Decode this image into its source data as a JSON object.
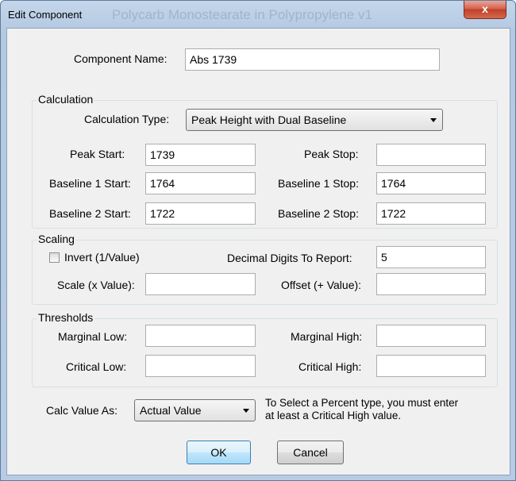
{
  "window": {
    "title": "Edit Component",
    "background_title": "Polycarb Monostearate in Polypropylene v1",
    "close_glyph": "x"
  },
  "component_name": {
    "label": "Component Name:",
    "value": "Abs 1739"
  },
  "calculation": {
    "group_title": "Calculation",
    "type_label": "Calculation Type:",
    "type_value": "Peak Height with Dual Baseline",
    "peak_start_label": "Peak Start:",
    "peak_start_value": "1739",
    "peak_stop_label": "Peak Stop:",
    "peak_stop_value": "",
    "b1_start_label": "Baseline 1 Start:",
    "b1_start_value": "1764",
    "b1_stop_label": "Baseline 1 Stop:",
    "b1_stop_value": "1764",
    "b2_start_label": "Baseline 2 Start:",
    "b2_start_value": "1722",
    "b2_stop_label": "Baseline 2 Stop:",
    "b2_stop_value": "1722"
  },
  "scaling": {
    "group_title": "Scaling",
    "invert_label": "Invert (1/Value)",
    "invert_checked": false,
    "decimal_label": "Decimal Digits To Report:",
    "decimal_value": "5",
    "scale_label": "Scale (x Value):",
    "scale_value": "",
    "offset_label": "Offset (+ Value):",
    "offset_value": ""
  },
  "thresholds": {
    "group_title": "Thresholds",
    "marginal_low_label": "Marginal Low:",
    "marginal_low_value": "",
    "marginal_high_label": "Marginal High:",
    "marginal_high_value": "",
    "critical_low_label": "Critical Low:",
    "critical_low_value": "",
    "critical_high_label": "Critical High:",
    "critical_high_value": ""
  },
  "calc_value": {
    "label": "Calc Value As:",
    "value": "Actual Value",
    "note_line1": "To Select a Percent type, you must enter",
    "note_line2": "at least a Critical High value."
  },
  "buttons": {
    "ok": "OK",
    "cancel": "Cancel"
  },
  "colors": {
    "title_bar": "#b9cde5",
    "close_button": "#c9452e",
    "dialog_bg": "#f0f0f0",
    "ok_button": "#bee6fd"
  }
}
